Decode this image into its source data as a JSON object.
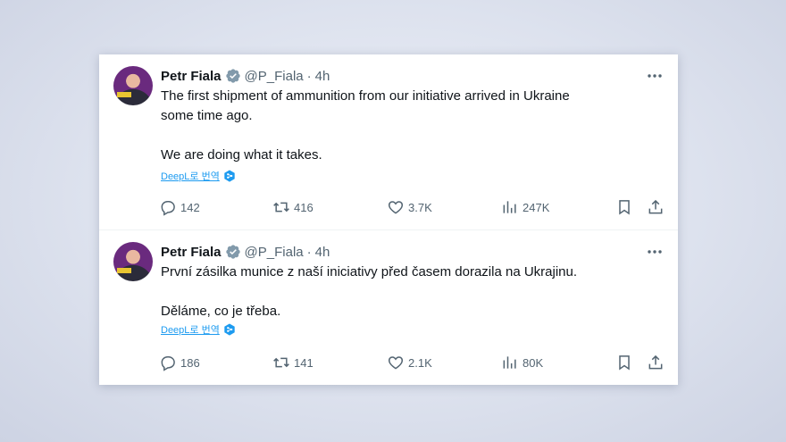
{
  "tweets": [
    {
      "author": "Petr Fiala",
      "handle": "@P_Fiala",
      "separator": "·",
      "time": "4h",
      "text": "The first shipment of ammunition from our initiative arrived in Ukraine\nsome time ago.\n\nWe are doing what it takes.",
      "translate_label": "DeepL로 번역",
      "replies": "142",
      "retweets": "416",
      "likes": "3.7K",
      "views": "247K"
    },
    {
      "author": "Petr Fiala",
      "handle": "@P_Fiala",
      "separator": "·",
      "time": "4h",
      "text": "První zásilka munice z naší iniciativy před časem dorazila na Ukrajinu.\n\nDěláme, co je třeba.",
      "translate_label": "DeepL로 번역",
      "replies": "186",
      "retweets": "141",
      "likes": "2.1K",
      "views": "80K"
    }
  ],
  "icons": {
    "verified": "verified-badge-icon",
    "more": "more-options-icon",
    "reply": "reply-icon",
    "retweet": "retweet-icon",
    "like": "heart-icon",
    "views": "views-icon",
    "bookmark": "bookmark-icon",
    "share": "share-icon",
    "deepl": "deepl-icon"
  },
  "colors": {
    "accent": "#1d9bf0",
    "text": "#0f1419",
    "muted": "#536471",
    "verified": "#829aab"
  }
}
